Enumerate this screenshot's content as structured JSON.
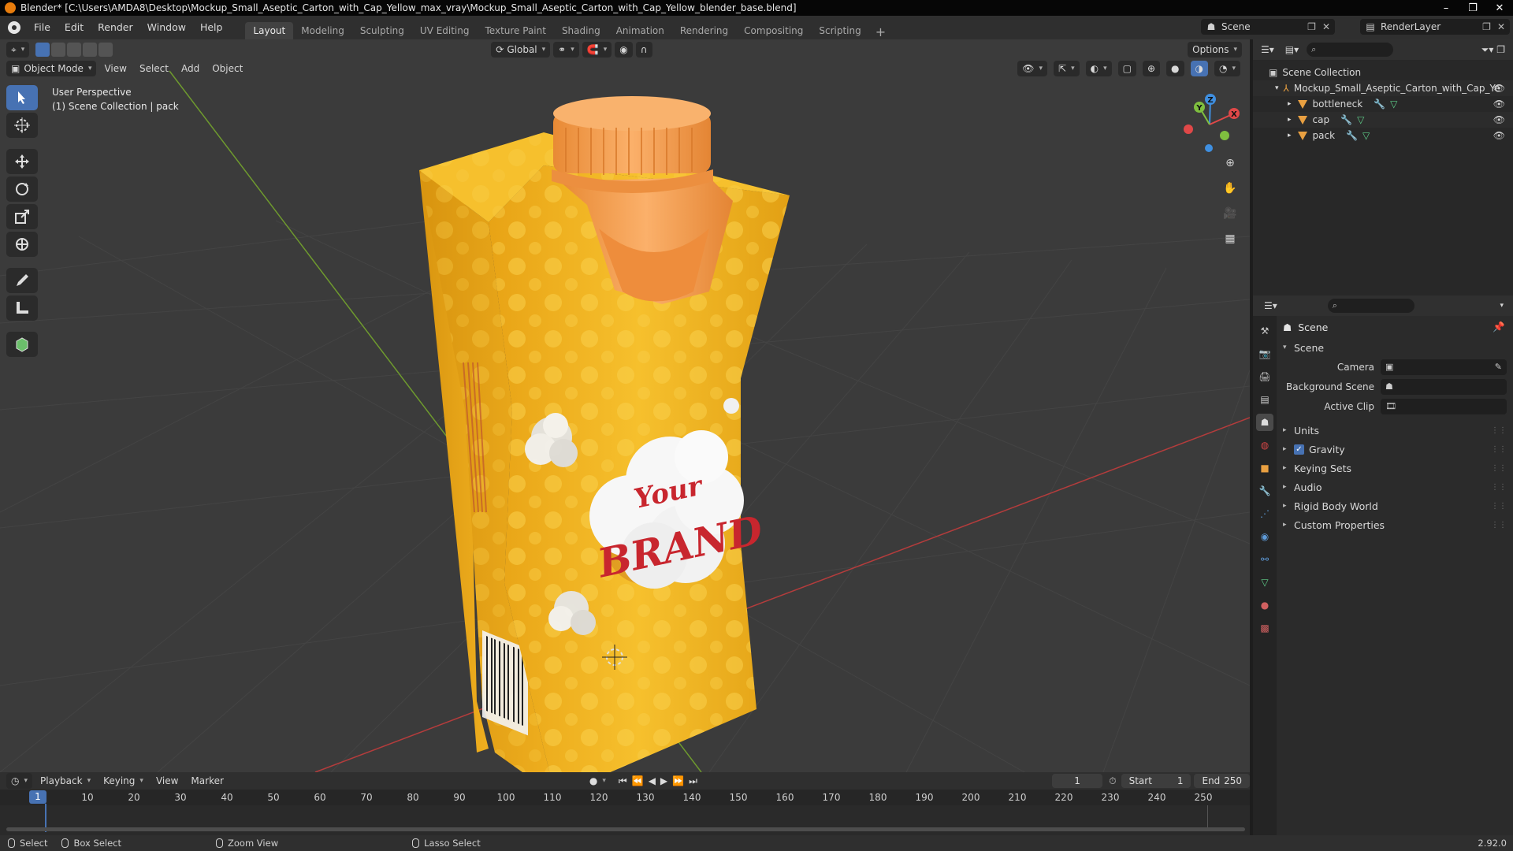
{
  "window": {
    "title": "Blender* [C:\\Users\\AMDA8\\Desktop\\Mockup_Small_Aseptic_Carton_with_Cap_Yellow_max_vray\\Mockup_Small_Aseptic_Carton_with_Cap_Yellow_blender_base.blend]",
    "min": "–",
    "max": "❐",
    "close": "✕"
  },
  "menu": [
    "File",
    "Edit",
    "Render",
    "Window",
    "Help"
  ],
  "workspaces": [
    "Layout",
    "Modeling",
    "Sculpting",
    "UV Editing",
    "Texture Paint",
    "Shading",
    "Animation",
    "Rendering",
    "Compositing",
    "Scripting"
  ],
  "workspace_active": "Layout",
  "scene_name": "Scene",
  "render_layer": "RenderLayer",
  "viewport": {
    "orientation": "Global",
    "options": "Options",
    "mode": "Object Mode",
    "menus": [
      "View",
      "Select",
      "Add",
      "Object"
    ],
    "info_line1": "User Perspective",
    "info_line2": "(1) Scene Collection | pack",
    "gizmo": {
      "x": "X",
      "y": "Y",
      "z": "Z"
    }
  },
  "model": {
    "brand_line1": "Your",
    "brand_line2": "BRAND"
  },
  "outliner": {
    "root": "Scene Collection",
    "collection": "Mockup_Small_Aseptic_Carton_with_Cap_Ye",
    "objects": [
      "bottleneck",
      "cap",
      "pack"
    ]
  },
  "properties": {
    "title": "Scene",
    "panel": "Scene",
    "camera_label": "Camera",
    "bg_scene_label": "Background Scene",
    "active_clip_label": "Active Clip",
    "subpanels": [
      "Units",
      "Gravity",
      "Keying Sets",
      "Audio",
      "Rigid Body World",
      "Custom Properties"
    ],
    "gravity_checked": true
  },
  "timeline": {
    "menus": [
      "Playback",
      "Keying",
      "View",
      "Marker"
    ],
    "current_frame": "1",
    "start_label": "Start",
    "start": "1",
    "end_label": "End",
    "end": "250",
    "ticks": [
      "1",
      "10",
      "20",
      "30",
      "40",
      "50",
      "60",
      "70",
      "80",
      "90",
      "100",
      "110",
      "120",
      "130",
      "140",
      "150",
      "160",
      "170",
      "180",
      "190",
      "200",
      "210",
      "220",
      "230",
      "240",
      "250"
    ]
  },
  "status": {
    "select": "Select",
    "box_select": "Box Select",
    "zoom_view": "Zoom View",
    "lasso_select": "Lasso Select",
    "version": "2.92.0"
  },
  "colors": {
    "accent": "#4772b3",
    "carton": "#f2b320",
    "cap": "#f39a4a",
    "x_axis": "#e04848",
    "y_axis": "#7fbf3f",
    "z_axis": "#3f8fe0"
  }
}
